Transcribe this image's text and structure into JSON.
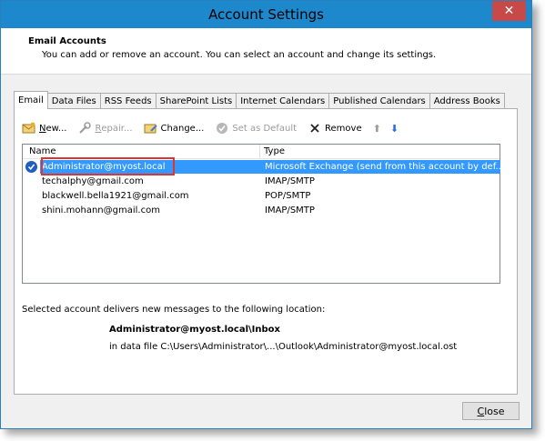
{
  "window": {
    "title": "Account Settings",
    "close_glyph": "✕"
  },
  "header": {
    "title": "Email Accounts",
    "description": "You can add or remove an account. You can select an account and change its settings."
  },
  "tabs": [
    "Email",
    "Data Files",
    "RSS Feeds",
    "SharePoint Lists",
    "Internet Calendars",
    "Published Calendars",
    "Address Books"
  ],
  "toolbar": {
    "new": {
      "label_u": "N",
      "label_rest": "ew...",
      "icon": "new-account-icon"
    },
    "repair": {
      "label_u": "R",
      "label_rest": "epair...",
      "icon": "repair-icon"
    },
    "change": {
      "label_u": "",
      "label_rest": "Change...",
      "icon": "change-icon"
    },
    "set_default": {
      "label_u": "",
      "label_rest": "Set as Default",
      "icon": "check-circle-icon"
    },
    "remove": {
      "label_u": "",
      "label_rest": "Remove",
      "icon": "x-icon"
    },
    "move_up_glyph": "⬆",
    "move_down_glyph": "⬇"
  },
  "accounts": {
    "columns": {
      "name": "Name",
      "type": "Type"
    },
    "rows": [
      {
        "name": "Administrator@myost.local",
        "type": "Microsoft Exchange (send from this account by def...",
        "selected": true,
        "default": true
      },
      {
        "name": "techalphy@gmail.com",
        "type": "IMAP/SMTP"
      },
      {
        "name": "blackwell.bella1921@gmail.com",
        "type": "POP/SMTP"
      },
      {
        "name": "shini.mohann@gmail.com",
        "type": "IMAP/SMTP"
      }
    ]
  },
  "delivery": {
    "label": "Selected account delivers new messages to the following location:",
    "inbox": "Administrator@myost.local\\Inbox",
    "data_file": "in data file C:\\Users\\Administrator\\...\\Outlook\\Administrator@myost.local.ost"
  },
  "close_button": {
    "label_u": "C",
    "label_rest": "lose"
  },
  "colors": {
    "titlebar": "#1e88cc",
    "selection": "#3399ff",
    "highlight": "#e0342e"
  }
}
